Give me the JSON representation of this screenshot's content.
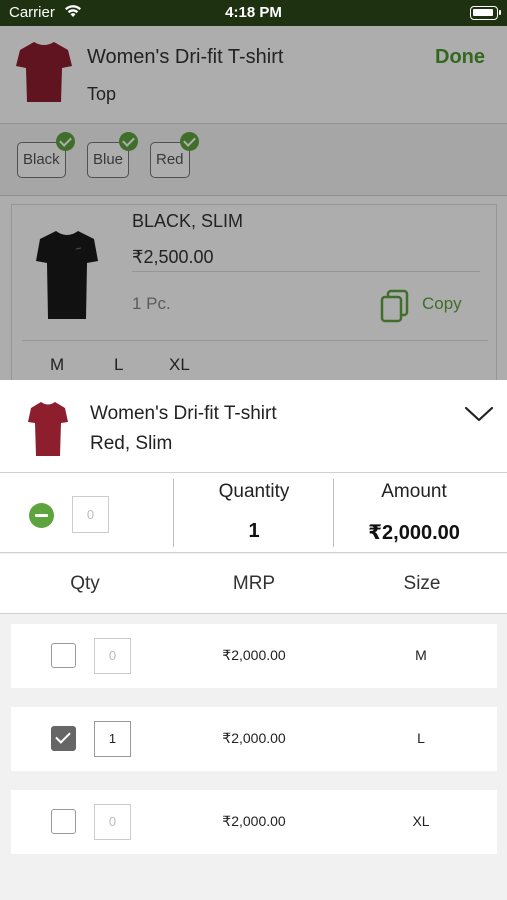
{
  "status_bar": {
    "carrier": "Carrier",
    "time": "4:18 PM"
  },
  "product": {
    "name": "Women's Dri-fit T-shirt",
    "category": "Top",
    "done_label": "Done"
  },
  "colors": [
    {
      "label": "Black",
      "selected": true
    },
    {
      "label": "Blue",
      "selected": true
    },
    {
      "label": "Red",
      "selected": true
    }
  ],
  "variant_card": {
    "title": "BLACK, SLIM",
    "price": "₹2,500.00",
    "pieces": "1 Pc.",
    "copy_label": "Copy",
    "sizes": [
      "M",
      "L",
      "XL"
    ]
  },
  "sheet": {
    "title": "Women's Dri-fit T-shirt",
    "subtitle": "Red, Slim",
    "input_value": "0",
    "quantity_label": "Quantity",
    "quantity_value": "1",
    "amount_label": "Amount",
    "amount_value": "₹2,000.00",
    "columns": {
      "qty": "Qty",
      "mrp": "MRP",
      "size": "Size"
    },
    "rows": [
      {
        "checked": false,
        "qty": "0",
        "mrp": "₹2,000.00",
        "size": "M"
      },
      {
        "checked": true,
        "qty": "1",
        "mrp": "₹2,000.00",
        "size": "L"
      },
      {
        "checked": false,
        "qty": "0",
        "mrp": "₹2,000.00",
        "size": "XL"
      }
    ]
  },
  "theme": {
    "accent": "#5da43e",
    "status_bar": "#1e3212",
    "shirt_red": "#8c1e2e",
    "shirt_black": "#1a1a1a"
  }
}
